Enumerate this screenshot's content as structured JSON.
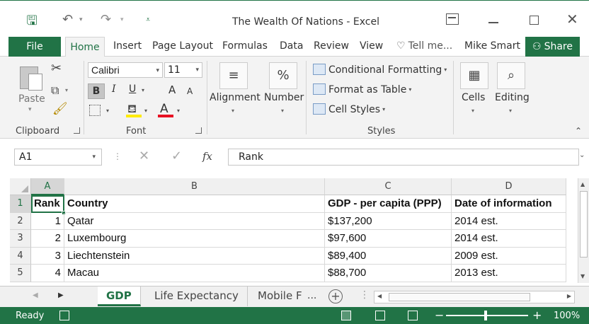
{
  "window": {
    "title": "The Wealth Of Nations - Excel",
    "icons": [
      "save-icon",
      "undo-icon",
      "redo-icon",
      "ribbon-display-icon",
      "minimize-icon",
      "maximize-icon",
      "close-icon"
    ]
  },
  "tabs": {
    "file": "File",
    "home": "Home",
    "insert": "Insert",
    "page_layout": "Page Layout",
    "formulas": "Formulas",
    "data": "Data",
    "review": "Review",
    "view": "View",
    "tell_me": "Tell me...",
    "user": "Mike Smart",
    "share": "Share"
  },
  "ribbon": {
    "clipboard": {
      "paste": "Paste",
      "label": "Clipboard"
    },
    "font": {
      "name": "Calibri",
      "size": "11",
      "bold": "B",
      "italic": "I",
      "underline": "U",
      "grow": "A",
      "shrink": "A",
      "color_letter": "A",
      "label": "Font",
      "fill_color": "#ffeb00",
      "font_color": "#e81123"
    },
    "alignment": {
      "label": "Alignment",
      "icon": "≡"
    },
    "number": {
      "label": "Number",
      "icon": "%"
    },
    "styles": {
      "conditional": "Conditional Formatting",
      "format_table": "Format as Table",
      "cell_styles": "Cell Styles",
      "label": "Styles"
    },
    "cells": {
      "label": "Cells",
      "icon": "▦"
    },
    "editing": {
      "label": "Editing",
      "icon": "⌕"
    }
  },
  "formula_bar": {
    "name_box": "A1",
    "fx": "fx",
    "content": "Rank"
  },
  "grid": {
    "columns": [
      "A",
      "B",
      "C",
      "D"
    ],
    "rows": [
      "1",
      "2",
      "3",
      "4",
      "5"
    ],
    "header": [
      "Rank",
      "Country",
      "GDP - per capita (PPP)",
      "Date of information"
    ],
    "data": [
      [
        "1",
        "Qatar",
        "$137,200",
        "2014 est."
      ],
      [
        "2",
        "Luxembourg",
        "$97,600",
        "2014 est."
      ],
      [
        "3",
        "Liechtenstein",
        "$89,400",
        "2009 est."
      ],
      [
        "4",
        "Macau",
        "$88,700",
        "2013 est."
      ]
    ]
  },
  "sheets": {
    "tabs": [
      "GDP",
      "Life Expectancy",
      "Mobile F"
    ],
    "more": "...",
    "active": "GDP"
  },
  "status": {
    "ready": "Ready",
    "zoom": "100%",
    "accent": "#217346"
  }
}
